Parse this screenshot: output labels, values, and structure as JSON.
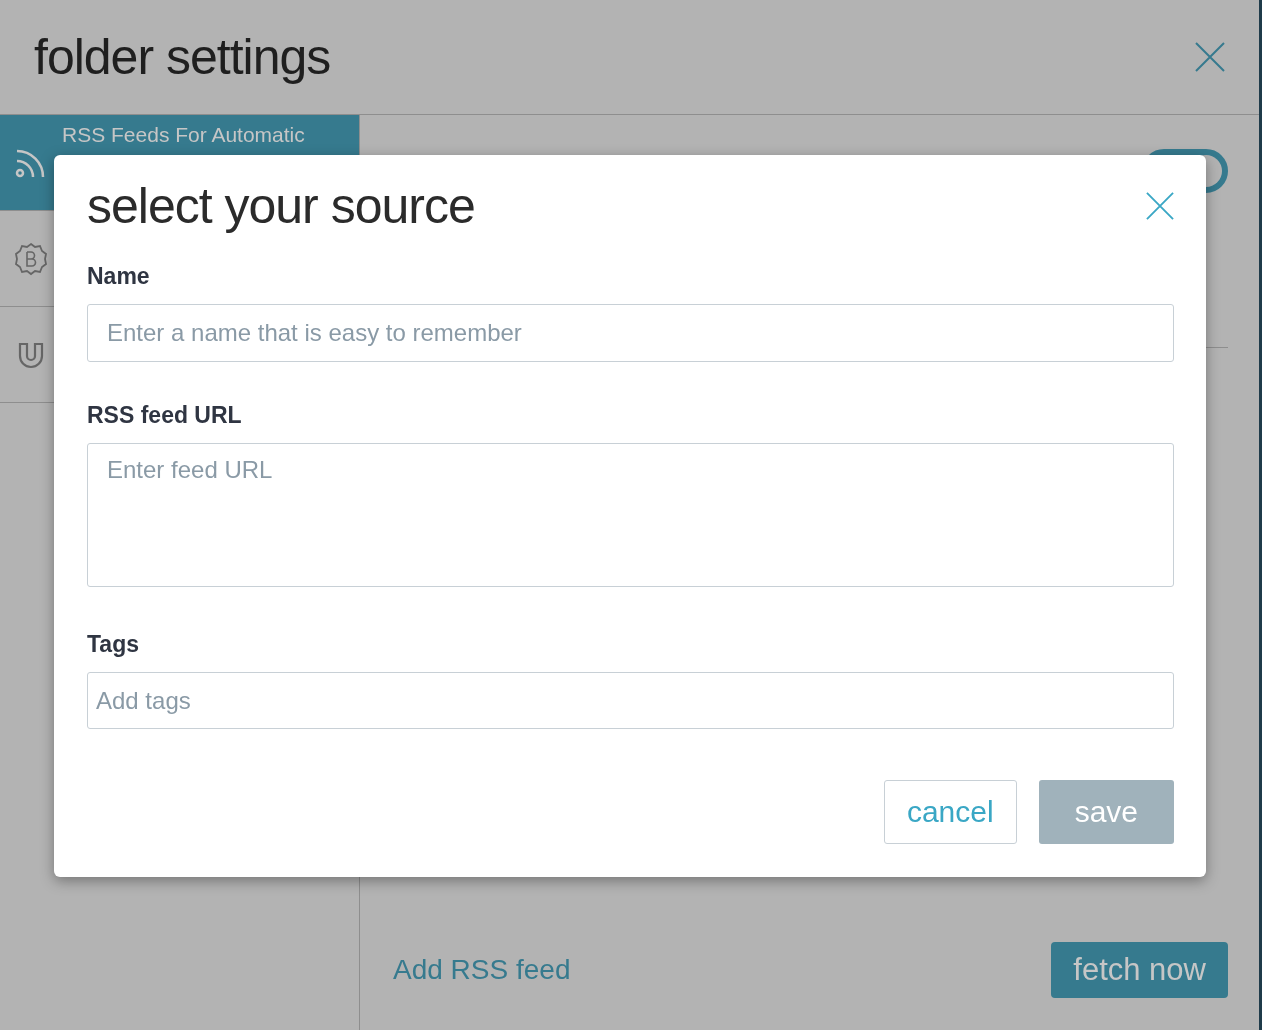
{
  "window": {
    "title": "folder settings"
  },
  "sidebar": {
    "items": [
      {
        "kind": "rss",
        "label": "RSS Feeds For Automatic",
        "selected": true
      },
      {
        "kind": "badge",
        "selected": false
      },
      {
        "kind": "magnet",
        "selected": false
      }
    ]
  },
  "content": {
    "toggle": {
      "on": true
    },
    "add_link": "Add RSS feed",
    "fetch_button": "fetch now"
  },
  "dialog": {
    "title": "select your source",
    "fields": [
      {
        "kind": "input",
        "label": "Name",
        "placeholder": "Enter a name that is easy to remember"
      },
      {
        "kind": "textarea",
        "label": "RSS feed URL",
        "placeholder": "Enter feed URL"
      },
      {
        "kind": "tags",
        "label": "Tags",
        "placeholder": "Add tags"
      }
    ],
    "buttons": [
      {
        "kind": "secondary",
        "label": "cancel"
      },
      {
        "kind": "primary",
        "label": "save",
        "disabled": true
      }
    ]
  }
}
